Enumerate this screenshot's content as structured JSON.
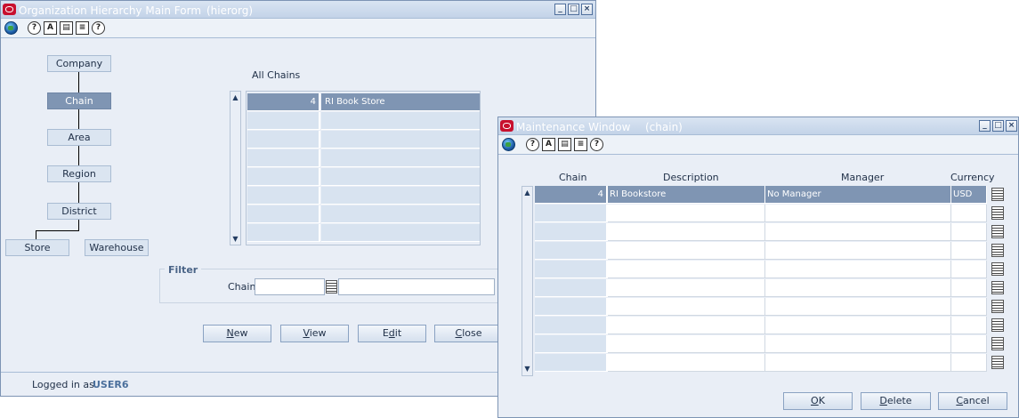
{
  "main_window": {
    "title": "Organization Hierarchy Main Form",
    "subtitle": "(hierorg)",
    "hierarchy": {
      "company": "Company",
      "chain": "Chain",
      "area": "Area",
      "region": "Region",
      "district": "District",
      "store": "Store",
      "warehouse": "Warehouse"
    },
    "list_title": "All Chains",
    "chains": [
      {
        "id": "4",
        "name": "RI Book Store"
      }
    ],
    "filter": {
      "legend": "Filter",
      "chain_label": "Chain",
      "chain_value": "",
      "chain_desc": ""
    },
    "buttons": {
      "new": {
        "ul": "N",
        "rest": "ew"
      },
      "view": {
        "ul": "V",
        "rest": "iew"
      },
      "edit": {
        "pre": "E",
        "ul": "d",
        "rest": "it"
      },
      "close": {
        "ul": "C",
        "rest": "lose"
      }
    },
    "status": {
      "logged_in_label": "Logged in as",
      "user": "USER6"
    }
  },
  "maint_window": {
    "title": "Maintenance Window",
    "subtitle": "(chain)",
    "columns": {
      "chain": "Chain",
      "description": "Description",
      "manager": "Manager",
      "currency": "Currency"
    },
    "rows": [
      {
        "chain": "4",
        "description": "RI Bookstore",
        "manager": "No Manager",
        "currency": "USD"
      }
    ],
    "buttons": {
      "ok": {
        "ul": "O",
        "rest": "K"
      },
      "delete": {
        "ul": "D",
        "rest": "elete"
      },
      "cancel": {
        "ul": "C",
        "rest": "ancel"
      }
    }
  },
  "icons": [
    "oracle-logo-icon",
    "globe-icon",
    "help-icon",
    "spellcheck-icon",
    "notebook-icon",
    "print-icon",
    "question-icon",
    "lov-icon"
  ]
}
